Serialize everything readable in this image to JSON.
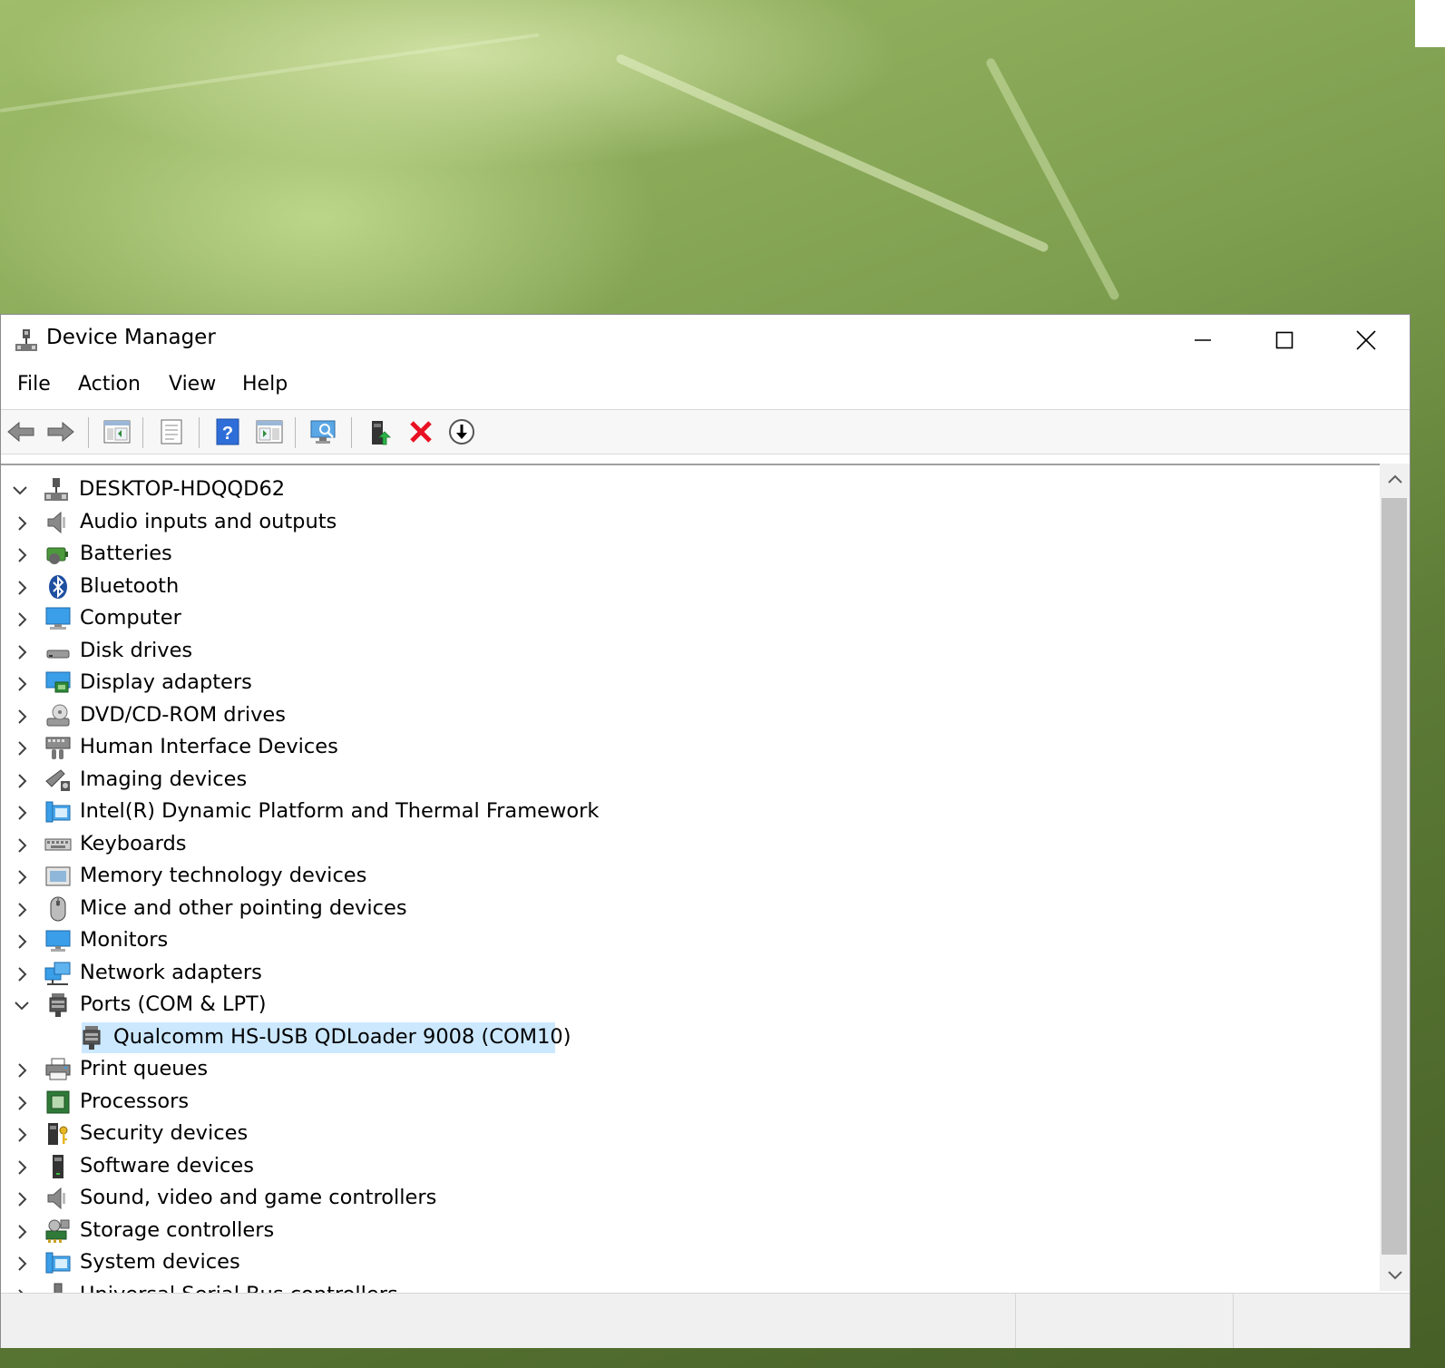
{
  "window": {
    "title": "Device Manager",
    "controls": {
      "minimize": "minimize",
      "maximize": "maximize",
      "close": "close"
    }
  },
  "menu": [
    "File",
    "Action",
    "View",
    "Help"
  ],
  "toolbar": {
    "buttons": [
      "back-arrow-icon",
      "forward-arrow-icon",
      "show-hide-console-tree-icon",
      "properties-icon",
      "help-icon",
      "action-pane-icon",
      "scan-hardware-icon",
      "update-driver-icon",
      "uninstall-device-icon",
      "disable-device-icon"
    ],
    "accent_red": "#e81123",
    "accent_blue": "#2f6ed8"
  },
  "tree": {
    "root": {
      "label": "DESKTOP-HDQQD62",
      "expanded": true
    },
    "categories": [
      {
        "label": "Audio inputs and outputs",
        "icon": "speaker-icon"
      },
      {
        "label": "Batteries",
        "icon": "battery-icon"
      },
      {
        "label": "Bluetooth",
        "icon": "bluetooth-icon"
      },
      {
        "label": "Computer",
        "icon": "computer-icon"
      },
      {
        "label": "Disk drives",
        "icon": "disk-drive-icon"
      },
      {
        "label": "Display adapters",
        "icon": "display-adapter-icon"
      },
      {
        "label": "DVD/CD-ROM drives",
        "icon": "dvd-drive-icon"
      },
      {
        "label": "Human Interface Devices",
        "icon": "hid-icon"
      },
      {
        "label": "Imaging devices",
        "icon": "camera-icon"
      },
      {
        "label": "Intel(R) Dynamic Platform and Thermal Framework",
        "icon": "folder-device-icon"
      },
      {
        "label": "Keyboards",
        "icon": "keyboard-icon"
      },
      {
        "label": "Memory technology devices",
        "icon": "memory-card-icon"
      },
      {
        "label": "Mice and other pointing devices",
        "icon": "mouse-icon"
      },
      {
        "label": "Monitors",
        "icon": "monitor-icon"
      },
      {
        "label": "Network adapters",
        "icon": "network-icon"
      },
      {
        "label": "Ports (COM & LPT)",
        "icon": "port-icon",
        "expanded": true,
        "children": [
          {
            "label": "Qualcomm HS-USB QDLoader 9008 (COM10)",
            "icon": "port-icon",
            "selected": true
          }
        ]
      },
      {
        "label": "Print queues",
        "icon": "printer-icon"
      },
      {
        "label": "Processors",
        "icon": "processor-icon"
      },
      {
        "label": "Security devices",
        "icon": "security-key-icon"
      },
      {
        "label": "Software devices",
        "icon": "software-device-icon"
      },
      {
        "label": "Sound, video and game controllers",
        "icon": "speaker-icon"
      },
      {
        "label": "Storage controllers",
        "icon": "storage-controller-icon"
      },
      {
        "label": "System devices",
        "icon": "folder-device-icon"
      },
      {
        "label": "Universal Serial Bus controllers",
        "icon": "usb-icon"
      }
    ]
  },
  "colors": {
    "selection": "#cce8ff",
    "window_bg": "#ffffff",
    "chrome_bg": "#f0f0f0"
  }
}
